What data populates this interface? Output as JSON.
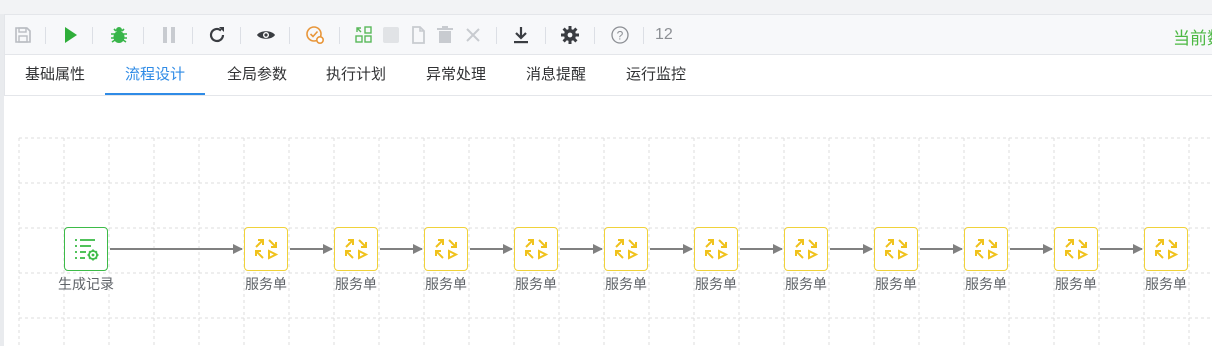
{
  "toolbar": {
    "buttons": [
      "save-icon",
      "run-icon",
      "debug-icon",
      "pause-icon",
      "refresh-icon",
      "preview-icon",
      "settings-check-icon",
      "select-nodes-icon",
      "checkbox-icon",
      "copy-icon",
      "delete-icon",
      "close-icon",
      "download-icon",
      "gear-icon",
      "help-icon"
    ],
    "zoom": "12",
    "current_data_label": "当前数"
  },
  "tabs": [
    {
      "label": "基础属性",
      "active": false
    },
    {
      "label": "流程设计",
      "active": true
    },
    {
      "label": "全局参数",
      "active": false
    },
    {
      "label": "执行计划",
      "active": false
    },
    {
      "label": "异常处理",
      "active": false
    },
    {
      "label": "消息提醒",
      "active": false
    },
    {
      "label": "运行监控",
      "active": false
    }
  ],
  "flow": {
    "start_node": {
      "label": "生成记录",
      "icon": "list-gear-icon"
    },
    "service_nodes": [
      {
        "label": "服务单",
        "icon": "transfer-arrows-icon"
      },
      {
        "label": "服务单",
        "icon": "transfer-arrows-icon"
      },
      {
        "label": "服务单",
        "icon": "transfer-arrows-icon"
      },
      {
        "label": "服务单",
        "icon": "transfer-arrows-icon"
      },
      {
        "label": "服务单",
        "icon": "transfer-arrows-icon"
      },
      {
        "label": "服务单",
        "icon": "transfer-arrows-icon"
      },
      {
        "label": "服务单",
        "icon": "transfer-arrows-icon"
      },
      {
        "label": "服务单",
        "icon": "transfer-arrows-icon"
      },
      {
        "label": "服务单",
        "icon": "transfer-arrows-icon"
      },
      {
        "label": "服务单",
        "icon": "transfer-arrows-icon"
      },
      {
        "label": "服务单",
        "icon": "transfer-arrows-icon"
      }
    ]
  },
  "colors": {
    "accent": "#2f8be6",
    "start_node": "#3dbb48",
    "service_node": "#f0d23a",
    "connector": "#808080",
    "current_data": "#4cb843"
  }
}
